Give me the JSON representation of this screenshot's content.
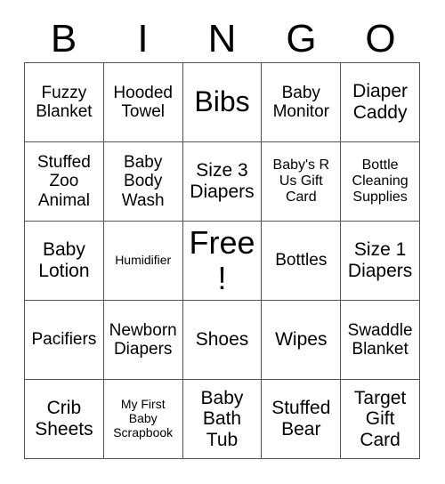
{
  "card": {
    "header_letters": [
      "B",
      "I",
      "N",
      "G",
      "O"
    ],
    "rows": [
      [
        {
          "label": "Fuzzy\nBlanket",
          "size": "sz-sm"
        },
        {
          "label": "Hooded\nTowel",
          "size": "sz-sm"
        },
        {
          "label": "Bibs",
          "size": "sz-lg"
        },
        {
          "label": "Baby\nMonitor",
          "size": "sz-sm"
        },
        {
          "label": "Diaper\nCaddy",
          "size": "sz-md"
        }
      ],
      [
        {
          "label": "Stuffed\nZoo\nAnimal",
          "size": "sz-sm"
        },
        {
          "label": "Baby\nBody\nWash",
          "size": "sz-sm"
        },
        {
          "label": "Size 3\nDiapers",
          "size": "sz-md"
        },
        {
          "label": "Baby's R\nUs Gift\nCard",
          "size": "sz-xs"
        },
        {
          "label": "Bottle\nCleaning\nSupplies",
          "size": "sz-xs"
        }
      ],
      [
        {
          "label": "Baby\nLotion",
          "size": "sz-md"
        },
        {
          "label": "Humidifier",
          "size": "sz-xxs"
        },
        {
          "label": "Free!",
          "size": "sz-xl"
        },
        {
          "label": "Bottles",
          "size": "sz-sm"
        },
        {
          "label": "Size 1\nDiapers",
          "size": "sz-md"
        }
      ],
      [
        {
          "label": "Pacifiers",
          "size": "sz-sm"
        },
        {
          "label": "Newborn\nDiapers",
          "size": "sz-sm"
        },
        {
          "label": "Shoes",
          "size": "sz-md"
        },
        {
          "label": "Wipes",
          "size": "sz-md"
        },
        {
          "label": "Swaddle\nBlanket",
          "size": "sz-sm"
        }
      ],
      [
        {
          "label": "Crib\nSheets",
          "size": "sz-md"
        },
        {
          "label": "My First\nBaby\nScrapbook",
          "size": "sz-xxs"
        },
        {
          "label": "Baby\nBath\nTub",
          "size": "sz-md"
        },
        {
          "label": "Stuffed\nBear",
          "size": "sz-md"
        },
        {
          "label": "Target\nGift\nCard",
          "size": "sz-md"
        }
      ]
    ],
    "colors": {
      "background": "#ffffff",
      "text": "#000000",
      "grid_line": "#555555"
    }
  }
}
